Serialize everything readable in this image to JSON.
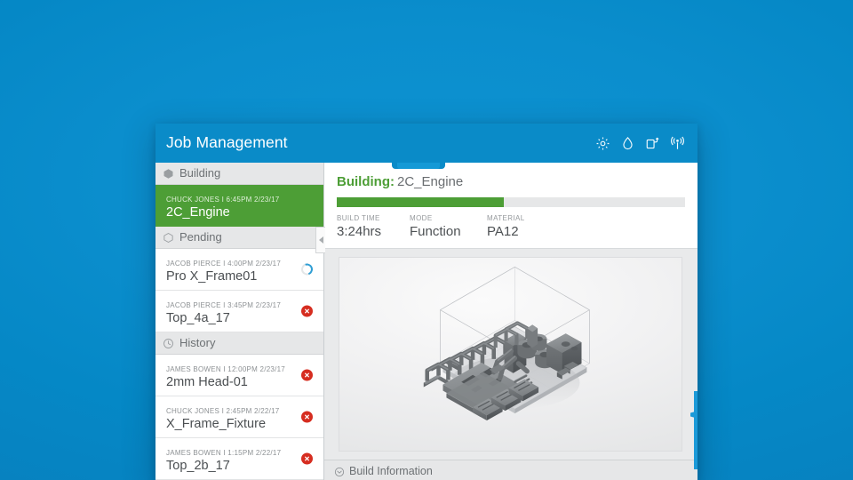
{
  "header": {
    "title": "Job Management",
    "icons": [
      {
        "name": "gear-icon"
      },
      {
        "name": "droplet-icon"
      },
      {
        "name": "material-cartridge-icon"
      },
      {
        "name": "wireless-signal-icon"
      }
    ]
  },
  "sidebar": {
    "sections": [
      {
        "label": "Building",
        "icon": "cube-solid-icon",
        "jobs": [
          {
            "meta": "CHUCK JONES  I  6:45PM 2/23/17",
            "name": "2C_Engine",
            "state": "active",
            "status": "none"
          }
        ]
      },
      {
        "label": "Pending",
        "icon": "cube-outline-icon",
        "jobs": [
          {
            "meta": "JACOB PIERCE  I  4:00PM 2/23/17",
            "name": "Pro X_Frame01",
            "state": "normal",
            "status": "spinner"
          },
          {
            "meta": "JACOB PIERCE  I  3:45PM 2/23/17",
            "name": "Top_4a_17",
            "state": "normal",
            "status": "error"
          }
        ]
      },
      {
        "label": "History",
        "icon": "clock-icon",
        "jobs": [
          {
            "meta": "JAMES BOWEN  I  12:00PM 2/23/17",
            "name": "2mm Head-01",
            "state": "normal",
            "status": "error"
          },
          {
            "meta": "CHUCK JONES  I  2:45PM 2/22/17",
            "name": "X_Frame_Fixture",
            "state": "normal",
            "status": "error"
          },
          {
            "meta": "JAMES BOWEN  I  1:15PM 2/22/17",
            "name": "Top_2b_17",
            "state": "normal",
            "status": "error"
          }
        ]
      }
    ]
  },
  "main": {
    "build_label": "Building:",
    "build_name": "2C_Engine",
    "progress_percent": 48,
    "stats": [
      {
        "label": "BUILD TIME",
        "value": "3:24hrs"
      },
      {
        "label": "MODE",
        "value": "Function"
      },
      {
        "label": "MATERIAL",
        "value": "PA12"
      }
    ],
    "viewer": {
      "name": "3d-build-chamber-preview",
      "description": "Isometric 3D render of packed machine parts inside a wireframe build chamber"
    },
    "build_information_label": "Build Information",
    "build_information_icon": "chevron-circle-icon"
  },
  "colors": {
    "brand_blue": "#0a8bc8",
    "accent_blue": "#1b9ad8",
    "build_green": "#4d9e36",
    "error_red": "#d62d20",
    "panel_grey": "#e6e7e8"
  }
}
